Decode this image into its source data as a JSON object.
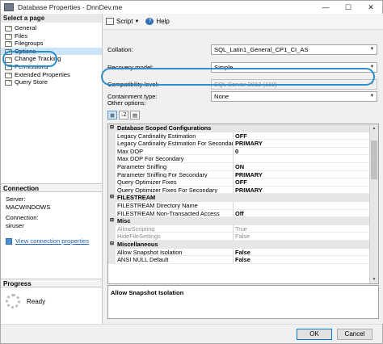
{
  "window": {
    "title": "Database Properties - DnnDev.me"
  },
  "window_controls": {
    "minimize": "—",
    "maximize": "☐",
    "close": "✕"
  },
  "left": {
    "select_page_header": "Select a page",
    "pages": [
      {
        "label": "General"
      },
      {
        "label": "Files"
      },
      {
        "label": "Filegroups"
      },
      {
        "label": "Options"
      },
      {
        "label": "Change Tracking"
      },
      {
        "label": "Permissions"
      },
      {
        "label": "Extended Properties"
      },
      {
        "label": "Query Store"
      }
    ],
    "connection_header": "Connection",
    "server_label": "Server:",
    "server_value": "MACWINDOWS",
    "connection_label": "Connection:",
    "connection_value": "siruser",
    "view_connection_link": "View connection properties",
    "progress_header": "Progress",
    "progress_status": "Ready"
  },
  "toolbar": {
    "script_label": "Script",
    "help_label": "Help",
    "help_icon": "?"
  },
  "form": {
    "collation_label": "Collation:",
    "collation_value": "SQL_Latin1_General_CP1_CI_AS",
    "recovery_label": "Recovery model:",
    "recovery_value": "Simple",
    "compat_label": "Compatibility level:",
    "compat_value": "SQL Server 2012 (110)",
    "containment_label": "Containment type:",
    "containment_value": "None",
    "other_options_label": "Other options:"
  },
  "grid_tools": {
    "categorized": "⊞",
    "alphabetical": "↓Z",
    "pages": "▤"
  },
  "grid": {
    "rows": [
      {
        "type": "cat",
        "name": "Database Scoped Configurations"
      },
      {
        "type": "prop",
        "name": "Legacy Cardinality Estimation",
        "value": "OFF"
      },
      {
        "type": "prop",
        "name": "Legacy Cardinality Estimation For Secondary",
        "value": "PRIMARY"
      },
      {
        "type": "prop",
        "name": "Max DOP",
        "value": "0"
      },
      {
        "type": "prop",
        "name": "Max DOP For Secondary",
        "value": ""
      },
      {
        "type": "prop",
        "name": "Parameter Sniffing",
        "value": "ON"
      },
      {
        "type": "prop",
        "name": "Parameter Sniffing For Secondary",
        "value": "PRIMARY"
      },
      {
        "type": "prop",
        "name": "Query Optimizer Fixes",
        "value": "OFF"
      },
      {
        "type": "prop",
        "name": "Query Optimizer Fixes For Secondary",
        "value": "PRIMARY"
      },
      {
        "type": "cat",
        "name": "FILESTREAM"
      },
      {
        "type": "prop",
        "name": "FILESTREAM Directory Name",
        "value": ""
      },
      {
        "type": "prop",
        "name": "FILESTREAM Non-Transacted Access",
        "value": "Off"
      },
      {
        "type": "cat",
        "name": "Misc"
      },
      {
        "type": "ro",
        "name": "AllowScripting",
        "value": "True"
      },
      {
        "type": "ro",
        "name": "HideFileSettings",
        "value": "False"
      },
      {
        "type": "cat",
        "name": "Miscellaneous"
      },
      {
        "type": "prop",
        "name": "Allow Snapshot Isolation",
        "value": "False"
      },
      {
        "type": "prop",
        "name": "ANSI NULL Default",
        "value": "False"
      }
    ]
  },
  "description": {
    "text": "Allow Snapshot Isolation"
  },
  "buttons": {
    "ok": "OK",
    "cancel": "Cancel"
  }
}
